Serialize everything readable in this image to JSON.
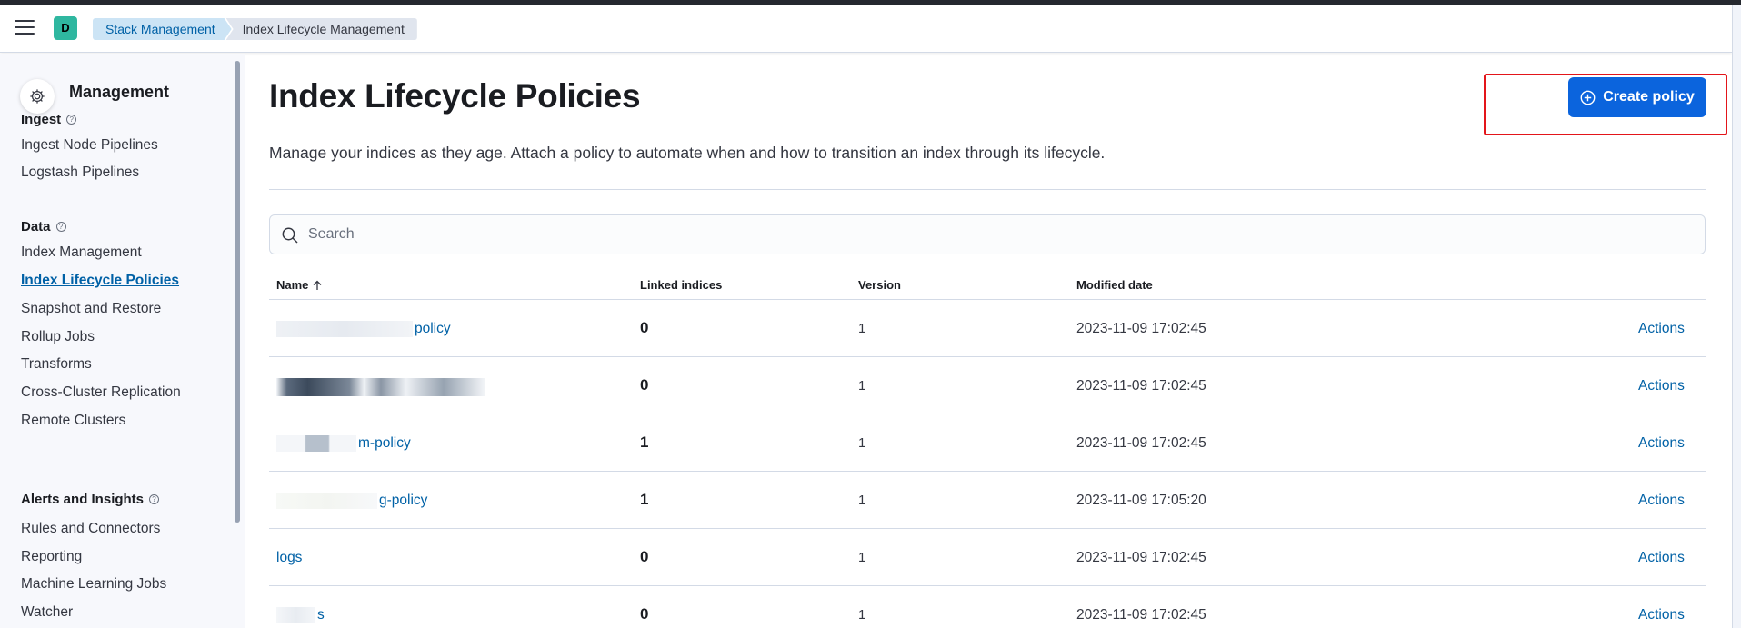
{
  "header": {
    "avatar_letter": "D",
    "breadcrumbs": [
      "Stack Management",
      "Index Lifecycle Management"
    ]
  },
  "sidebar": {
    "title": "Management",
    "sections": [
      {
        "label": "Ingest",
        "items": [
          "Ingest Node Pipelines",
          "Logstash Pipelines"
        ]
      },
      {
        "label": "Data",
        "items": [
          "Index Management",
          "Index Lifecycle Policies",
          "Snapshot and Restore",
          "Rollup Jobs",
          "Transforms",
          "Cross-Cluster Replication",
          "Remote Clusters"
        ]
      },
      {
        "label": "Alerts and Insights",
        "items": [
          "Rules and Connectors",
          "Reporting",
          "Machine Learning Jobs",
          "Watcher"
        ]
      }
    ],
    "active_item": "Index Lifecycle Policies"
  },
  "main": {
    "title": "Index Lifecycle Policies",
    "description": "Manage your indices as they age. Attach a policy to automate when and how to transition an index through its lifecycle.",
    "create_button": "Create policy",
    "search": {
      "placeholder": "Search",
      "value": ""
    },
    "table": {
      "columns": [
        "Name",
        "Linked indices",
        "Version",
        "Modified date"
      ],
      "sort_column": "Name",
      "sort_direction": "ascending",
      "rows": [
        {
          "name": "policy",
          "linked": "0",
          "version": "1",
          "modified": "2023-11-09 17:02:45",
          "action": "Actions"
        },
        {
          "name": "",
          "linked": "0",
          "version": "1",
          "modified": "2023-11-09 17:02:45",
          "action": "Actions"
        },
        {
          "name": "m-policy",
          "linked": "1",
          "version": "1",
          "modified": "2023-11-09 17:02:45",
          "action": "Actions"
        },
        {
          "name": "g-policy",
          "linked": "1",
          "version": "1",
          "modified": "2023-11-09 17:05:20",
          "action": "Actions"
        },
        {
          "name": "logs",
          "linked": "0",
          "version": "1",
          "modified": "2023-11-09 17:02:45",
          "action": "Actions"
        },
        {
          "name": "s",
          "linked": "0",
          "version": "1",
          "modified": "2023-11-09 17:02:45",
          "action": "Actions"
        }
      ]
    }
  },
  "colors": {
    "primary": "#0b64dd",
    "link": "#0061a6",
    "highlight_border": "#e3151a",
    "avatar": "#2fb7a0"
  }
}
